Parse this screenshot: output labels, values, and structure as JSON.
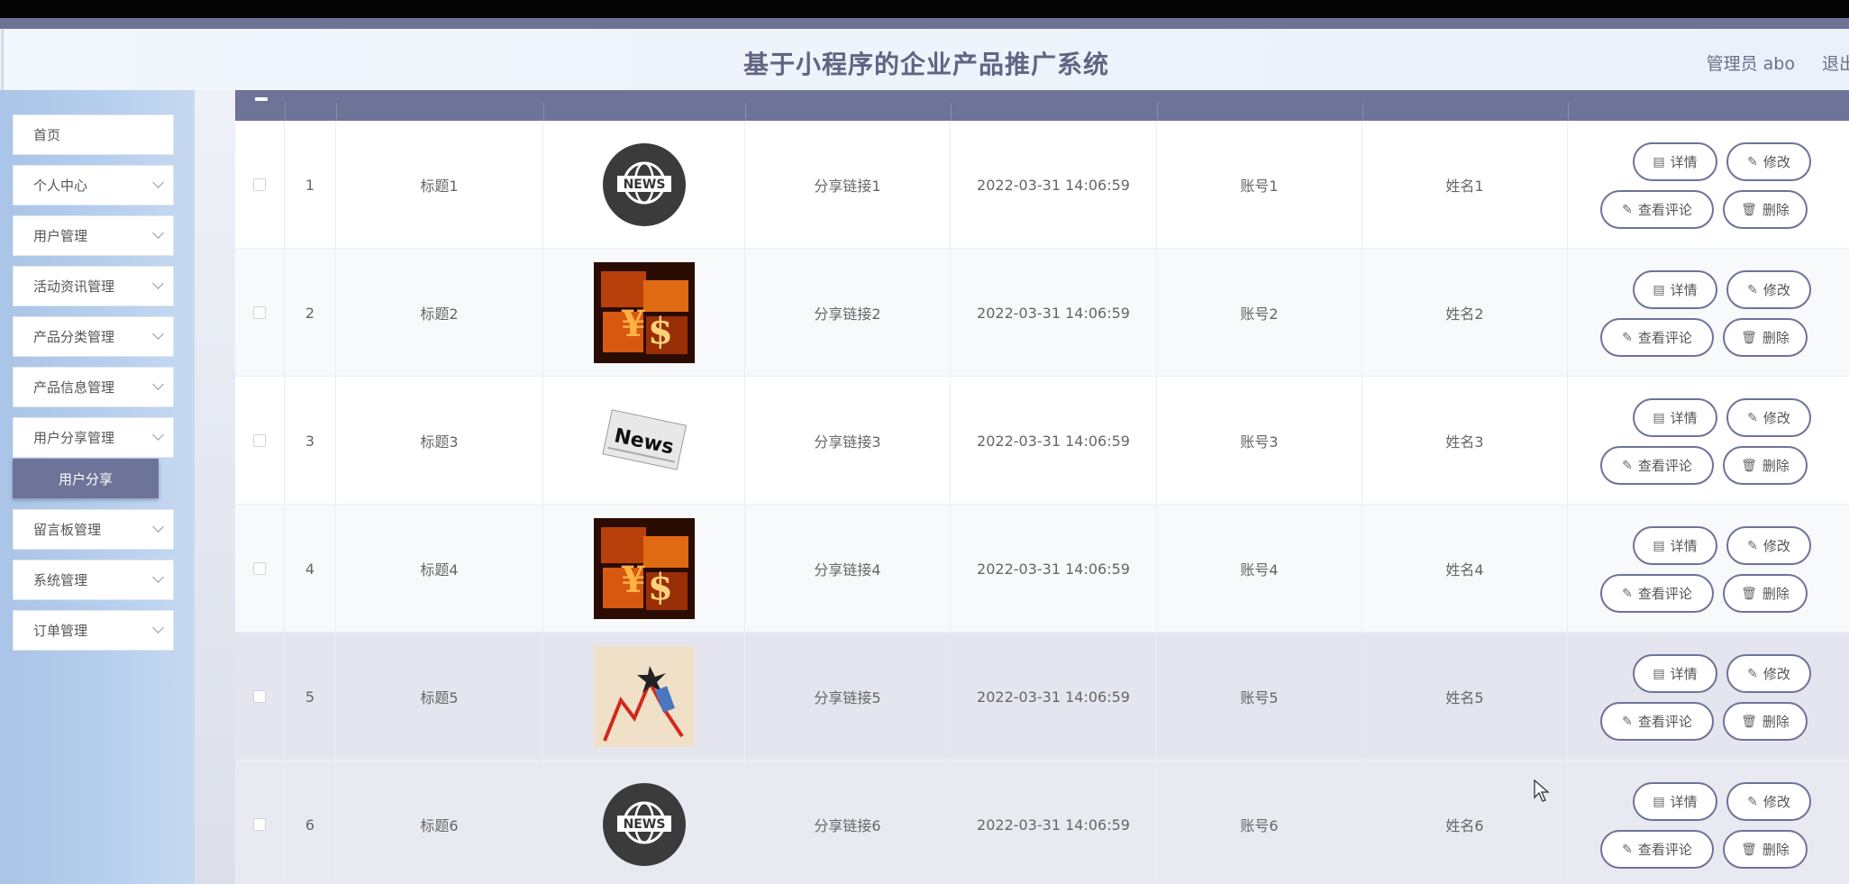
{
  "header": {
    "title": "基于小程序的企业产品推广系统",
    "user": "管理员 abo",
    "logout": "退出"
  },
  "sidebar": {
    "items": [
      {
        "label": "首页",
        "has_chevron": false
      },
      {
        "label": "个人中心",
        "has_chevron": true
      },
      {
        "label": "用户管理",
        "has_chevron": true
      },
      {
        "label": "活动资讯管理",
        "has_chevron": true
      },
      {
        "label": "产品分类管理",
        "has_chevron": true
      },
      {
        "label": "产品信息管理",
        "has_chevron": true
      },
      {
        "label": "用户分享管理",
        "has_chevron": true
      },
      {
        "label": "留言板管理",
        "has_chevron": true
      },
      {
        "label": "系统管理",
        "has_chevron": true
      },
      {
        "label": "订单管理",
        "has_chevron": true
      }
    ],
    "active_sub_item": "用户分享"
  },
  "table": {
    "rows": [
      {
        "index": "1",
        "title": "标题1",
        "image": "news-globe-icon",
        "link": "分享链接1",
        "time": "2022-03-31 14:06:59",
        "account": "账号1",
        "name": "姓名1"
      },
      {
        "index": "2",
        "title": "标题2",
        "image": "finance-money-image",
        "link": "分享链接2",
        "time": "2022-03-31 14:06:59",
        "account": "账号2",
        "name": "姓名2"
      },
      {
        "index": "3",
        "title": "标题3",
        "image": "news-paper-image",
        "link": "分享链接3",
        "time": "2022-03-31 14:06:59",
        "account": "账号3",
        "name": "姓名3"
      },
      {
        "index": "4",
        "title": "标题4",
        "image": "finance-money-image",
        "link": "分享链接4",
        "time": "2022-03-31 14:06:59",
        "account": "账号4",
        "name": "姓名4"
      },
      {
        "index": "5",
        "title": "标题5",
        "image": "stock-arrow-chart-image",
        "link": "分享链接5",
        "time": "2022-03-31 14:06:59",
        "account": "账号5",
        "name": "姓名5"
      },
      {
        "index": "6",
        "title": "标题6",
        "image": "news-globe-icon",
        "link": "分享链接6",
        "time": "2022-03-31 14:06:59",
        "account": "账号6",
        "name": "姓名6"
      }
    ],
    "actions": {
      "detail": "详情",
      "edit": "修改",
      "comments": "查看评论",
      "delete": "删除"
    }
  },
  "colors": {
    "accent": "#6e7398",
    "header_title": "#5f6582",
    "sidebar": "#b8d0ee"
  }
}
